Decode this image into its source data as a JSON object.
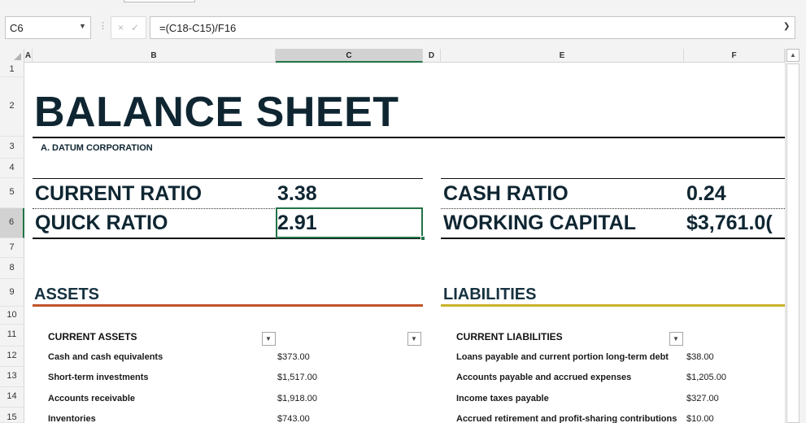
{
  "toolbar": {
    "namebox": "C6",
    "formula": "=(C18-C15)/F16",
    "cancel_icon": "×",
    "enter_icon": "✓",
    "fx_separator": "⋮"
  },
  "columns": [
    "A",
    "B",
    "C",
    "D",
    "E",
    "F"
  ],
  "rows": [
    "1",
    "2",
    "3",
    "4",
    "5",
    "6",
    "7",
    "8",
    "9",
    "10",
    "11",
    "12",
    "13",
    "14",
    "15"
  ],
  "sheet": {
    "title": "BALANCE SHEET",
    "company": "A. DATUM CORPORATION",
    "ratios": {
      "current_ratio_label": "CURRENT RATIO",
      "current_ratio_value": "3.38",
      "quick_ratio_label": "QUICK RATIO",
      "quick_ratio_value": "2.91",
      "cash_ratio_label": "CASH RATIO",
      "cash_ratio_value": "0.24",
      "working_capital_label": "WORKING CAPITAL",
      "working_capital_value": "$3,761.0("
    },
    "assets": {
      "heading": "ASSETS",
      "subheading": "CURRENT ASSETS",
      "items": [
        {
          "label": "Cash and cash equivalents",
          "value": "$373.00"
        },
        {
          "label": "Short-term investments",
          "value": "$1,517.00"
        },
        {
          "label": "Accounts receivable",
          "value": "$1,918.00"
        },
        {
          "label": "Inventories",
          "value": "$743.00"
        }
      ]
    },
    "liabilities": {
      "heading": "LIABILITIES",
      "subheading": "CURRENT LIABILITIES",
      "items": [
        {
          "label": "Loans payable and current portion long-term debt",
          "value": "$38.00"
        },
        {
          "label": "Accounts payable and accrued expenses",
          "value": "$1,205.00"
        },
        {
          "label": "Income taxes payable",
          "value": "$327.00"
        },
        {
          "label": "Accrued retirement and profit-sharing contributions",
          "value": "$10.00"
        }
      ]
    }
  },
  "colors": {
    "title": "#0f2632",
    "assets_accent": "#c0532b",
    "liabilities_accent": "#c9b22a",
    "selection": "#217346"
  },
  "icons": {
    "namebox_dropdown": "chevron-down-icon",
    "formula_expand": "chevron-down-icon",
    "filter": "filter-dropdown-icon",
    "scroll_up": "triangle-up-icon"
  }
}
